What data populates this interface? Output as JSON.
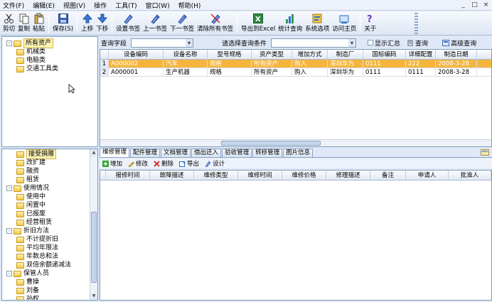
{
  "menu": [
    "文件(F)",
    "编辑(E)",
    "视图(V)",
    "操作",
    "工具(T)",
    "窗口(W)",
    "帮助(H)"
  ],
  "window_controls": [
    "_",
    "□",
    "×"
  ],
  "toolbar": [
    {
      "label": "剪切",
      "icon": "scissors-icon"
    },
    {
      "label": "复制",
      "icon": "copy-icon"
    },
    {
      "label": "粘贴",
      "icon": "paste-icon"
    },
    {
      "label": "保存(S)",
      "icon": "save-icon"
    },
    {
      "label": "上移",
      "icon": "arrow-up-icon"
    },
    {
      "label": "下移",
      "icon": "arrow-down-icon"
    },
    {
      "label": "设置书签",
      "icon": "bookmark-set-icon"
    },
    {
      "label": "上一书签",
      "icon": "bookmark-prev-icon"
    },
    {
      "label": "下一书签",
      "icon": "bookmark-next-icon"
    },
    {
      "label": "清除所有书签",
      "icon": "bookmark-clear-icon"
    },
    {
      "label": "导出到Excel",
      "icon": "excel-icon"
    },
    {
      "label": "统计查询",
      "icon": "stats-icon"
    },
    {
      "label": "系统选项",
      "icon": "options-icon"
    },
    {
      "label": "访问主页",
      "icon": "home-page-icon"
    },
    {
      "label": "关于",
      "icon": "help-icon"
    }
  ],
  "tree_top": [
    {
      "label": "所有资产",
      "level": 0,
      "expander": "-",
      "selected": true
    },
    {
      "label": "机械类",
      "level": 1
    },
    {
      "label": "电脑类",
      "level": 1
    },
    {
      "label": "交通工具类",
      "level": 1
    }
  ],
  "tree_bottom": [
    {
      "label": "接受捐赠",
      "level": 1,
      "selected": true
    },
    {
      "label": "改扩建",
      "level": 1
    },
    {
      "label": "融资",
      "level": 1
    },
    {
      "label": "租赁",
      "level": 1
    },
    {
      "label": "使用情况",
      "level": 0,
      "expander": "-"
    },
    {
      "label": "使用中",
      "level": 1
    },
    {
      "label": "闲置中",
      "level": 1
    },
    {
      "label": "已报废",
      "level": 1
    },
    {
      "label": "经营租赁",
      "level": 1
    },
    {
      "label": "折旧方法",
      "level": 0,
      "expander": "-"
    },
    {
      "label": "不计提折旧",
      "level": 1
    },
    {
      "label": "平均年限法",
      "level": 1
    },
    {
      "label": "年数总和法",
      "level": 1
    },
    {
      "label": "双倍余额递减法",
      "level": 1
    },
    {
      "label": "保管人员",
      "level": 0,
      "expander": "-"
    },
    {
      "label": "曹操",
      "level": 1
    },
    {
      "label": "刘备",
      "level": 1
    },
    {
      "label": "孙权",
      "level": 1
    }
  ],
  "search": {
    "field_label": "查询字段",
    "condition_label": "请选择查询条件",
    "summary_label": "显示汇总",
    "query_label": "查询",
    "advanced_label": "高级查询"
  },
  "assets": {
    "columns": [
      "",
      "设备编码",
      "设备名称",
      "型号规格",
      "资产类型",
      "增加方式",
      "制造厂",
      "国标编码",
      "详细配置",
      "制造日期"
    ],
    "rows": [
      [
        "1",
        "A000002",
        "汽车",
        "规格",
        "所有资产",
        "购入",
        "深圳华为",
        "0111",
        "222",
        "2008-3-28"
      ],
      [
        "2",
        "A000001",
        "生产机器",
        "规格",
        "所有资产",
        "购入",
        "深圳华为",
        "0111",
        "0111",
        "2008-3-28"
      ]
    ],
    "selected_row": 0
  },
  "tabs": [
    "维修管理",
    "配件管理",
    "文档管理",
    "借出还入",
    "验收管理",
    "转移管理",
    "图片信息"
  ],
  "active_tab": 0,
  "sub_toolbar": [
    {
      "label": "增加",
      "icon": "add-icon"
    },
    {
      "label": "修改",
      "icon": "edit-icon"
    },
    {
      "label": "删除",
      "icon": "delete-icon"
    },
    {
      "label": "导出",
      "icon": "export-icon"
    },
    {
      "label": "设计",
      "icon": "design-icon"
    }
  ],
  "repair": {
    "columns": [
      "报修时间",
      "故障描述",
      "维修类型",
      "维修时间",
      "维修价格",
      "修理描述",
      "备注",
      "申请人",
      "批准人"
    ]
  },
  "colors": {
    "selection": "#f5b53d",
    "tree_selection": "#fff6b6",
    "border": "#7f9db9",
    "background": "#dfe8f6"
  }
}
